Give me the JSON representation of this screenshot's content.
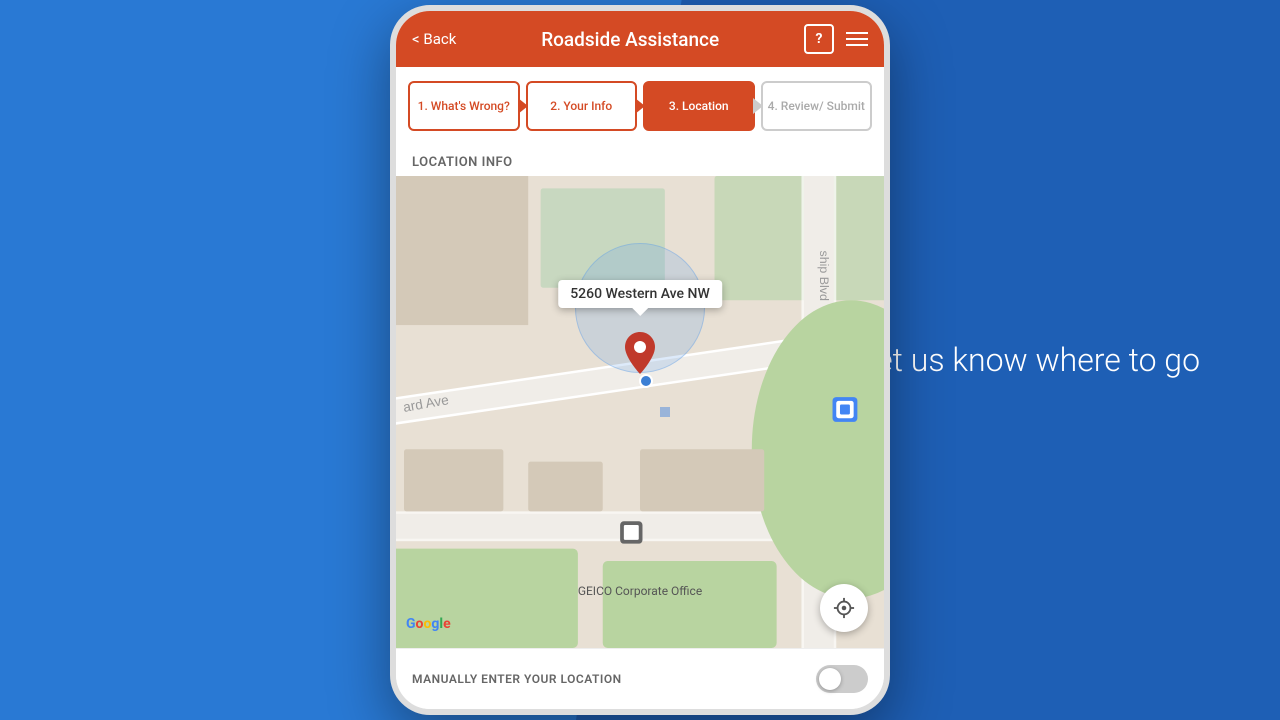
{
  "background": {
    "primary_color": "#2979d4",
    "secondary_color": "#1e5fb5"
  },
  "side_text": "Let us know where to go",
  "header": {
    "back_label": "< Back",
    "title": "Roadside Assistance",
    "question_icon": "?",
    "menu_icon": "hamburger"
  },
  "steps": [
    {
      "id": 1,
      "label": "1. What's Wrong?",
      "state": "outline"
    },
    {
      "id": 2,
      "label": "2. Your Info",
      "state": "outline"
    },
    {
      "id": 3,
      "label": "3. Location",
      "state": "active"
    },
    {
      "id": 4,
      "label": "4. Review/ Submit",
      "state": "disabled"
    }
  ],
  "location_section": {
    "label": "LOCATION INFO",
    "map_address": "5260 Western Ave NW",
    "geico_label": "GEICO Corporate Office",
    "google_label": "Google"
  },
  "manually_enter": {
    "label": "MANUALLY ENTER YOUR LOCATION",
    "toggle_state": "off"
  }
}
